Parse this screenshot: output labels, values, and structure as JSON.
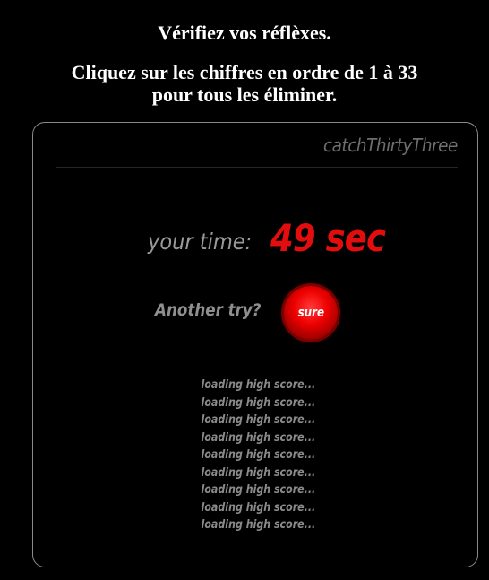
{
  "instructions": {
    "line1": "Vérifiez vos réflèxes.",
    "line2": "Cliquez sur les chiffres en ordre de 1 à 33",
    "line3": "pour tous les éliminer."
  },
  "game": {
    "title": "catchThirtyThree",
    "time_label": "your time:",
    "time_value": "49 sec",
    "retry_label": "Another try?",
    "retry_button": "sure",
    "high_scores": [
      "loading high score...",
      "loading high score...",
      "loading high score...",
      "loading high score...",
      "loading high score...",
      "loading high score...",
      "loading high score...",
      "loading high score...",
      "loading high score..."
    ]
  },
  "colors": {
    "background": "#000000",
    "time_value": "#e40d0d",
    "button": "#dd0000",
    "muted_text": "#8a8a8a"
  }
}
